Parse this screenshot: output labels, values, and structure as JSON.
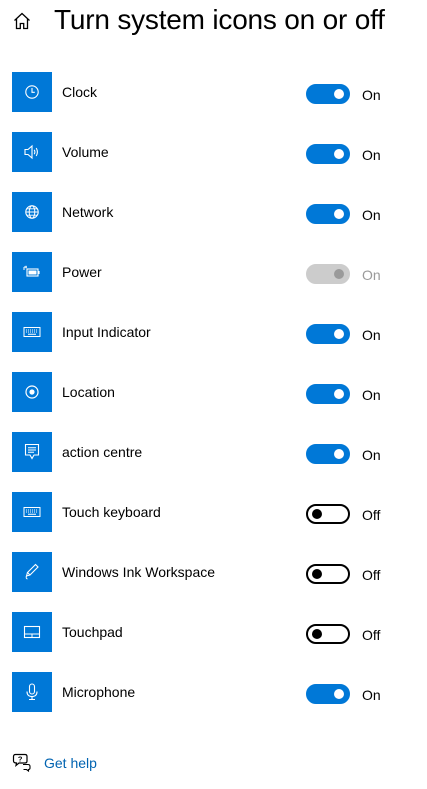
{
  "header": {
    "title": "Turn system icons on or off",
    "home_icon": "home-icon"
  },
  "colors": {
    "accent": "#0078d7",
    "toggle_off_border": "#000000",
    "toggle_disabled": "#cccccc",
    "link": "#0063b1"
  },
  "items": [
    {
      "label": "Clock",
      "icon": "clock-icon",
      "state": "On",
      "enabled": true,
      "checked": true
    },
    {
      "label": "Volume",
      "icon": "volume-icon",
      "state": "On",
      "enabled": true,
      "checked": true
    },
    {
      "label": "Network",
      "icon": "network-globe-icon",
      "state": "On",
      "enabled": true,
      "checked": true
    },
    {
      "label": "Power",
      "icon": "battery-power-icon",
      "state": "On",
      "enabled": false,
      "checked": true
    },
    {
      "label": "Input Indicator",
      "icon": "keyboard-icon",
      "state": "On",
      "enabled": true,
      "checked": true
    },
    {
      "label": "Location",
      "icon": "location-icon",
      "state": "On",
      "enabled": true,
      "checked": true
    },
    {
      "label": "action centre",
      "icon": "action-centre-icon",
      "state": "On",
      "enabled": true,
      "checked": true
    },
    {
      "label": "Touch keyboard",
      "icon": "touch-keyboard-icon",
      "state": "Off",
      "enabled": true,
      "checked": false
    },
    {
      "label": "Windows Ink Workspace",
      "icon": "pen-icon",
      "state": "Off",
      "enabled": true,
      "checked": false
    },
    {
      "label": "Touchpad",
      "icon": "touchpad-icon",
      "state": "Off",
      "enabled": true,
      "checked": false
    },
    {
      "label": "Microphone",
      "icon": "microphone-icon",
      "state": "On",
      "enabled": true,
      "checked": true
    }
  ],
  "help": {
    "label": "Get help",
    "icon": "help-chat-icon"
  }
}
